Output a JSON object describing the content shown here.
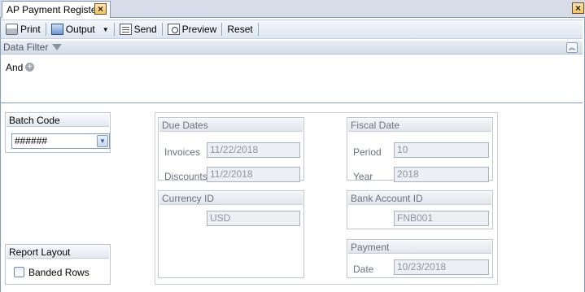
{
  "tab": {
    "title": "AP Payment Register",
    "close_glyph": "×"
  },
  "window": {
    "close_glyph": "×"
  },
  "toolbar": {
    "print": "Print",
    "output": "Output",
    "send": "Send",
    "preview": "Preview",
    "reset": "Reset",
    "dropdown_glyph": "▼"
  },
  "data_filter": {
    "title": "Data Filter",
    "operator": "And",
    "add_glyph": "+",
    "collapse_glyph": "︽"
  },
  "batch_code": {
    "title": "Batch Code",
    "value": "######",
    "dropdown_glyph": "▼"
  },
  "report_layout": {
    "title": "Report Layout",
    "banded_rows_label": "Banded Rows",
    "banded_rows_checked": false
  },
  "due_dates": {
    "title": "Due Dates",
    "invoices_label": "Invoices",
    "invoices_value": "11/22/2018",
    "discounts_label": "Discounts",
    "discounts_value": "11/2/2018"
  },
  "fiscal_date": {
    "title": "Fiscal Date",
    "period_label": "Period",
    "period_value": "10",
    "year_label": "Year",
    "year_value": "2018"
  },
  "currency": {
    "title": "Currency ID",
    "value": "USD"
  },
  "bank_account": {
    "title": "Bank Account ID",
    "value": "FNB001"
  },
  "payment": {
    "title": "Payment",
    "date_label": "Date",
    "date_value": "10/23/2018"
  },
  "colors": {
    "accent": "#8a9bb4",
    "close_button": "#f3c463",
    "disabled_field": "#eceff3"
  }
}
